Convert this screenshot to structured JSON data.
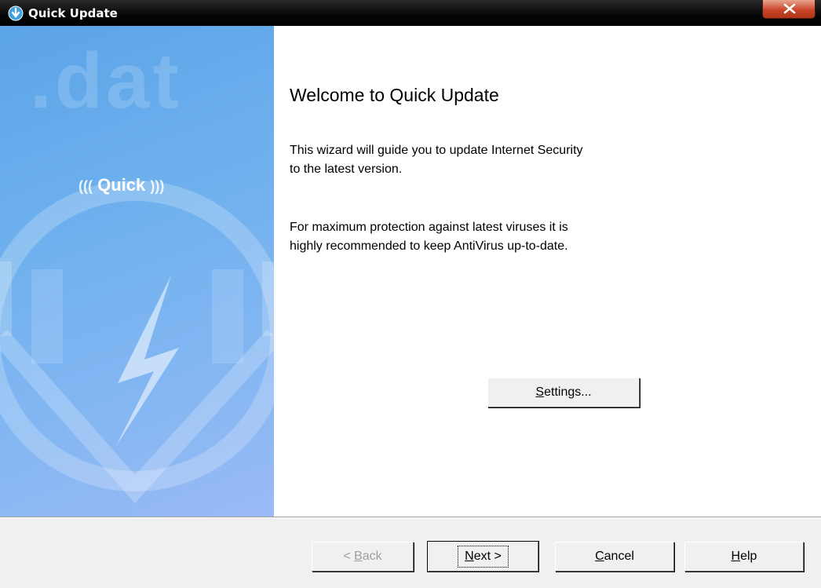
{
  "window": {
    "title": "Quick Update",
    "icon": "download-globe-icon",
    "close_icon": "close-icon"
  },
  "banner": {
    "watermark": ".dat",
    "quick_label": "Quick",
    "wave_left": "(((",
    "wave_right": ")))",
    "icon": "lightning-bolt-icon"
  },
  "content": {
    "heading": "Welcome to Quick Update",
    "paragraph1_line1": "This wizard will guide you to update Internet Security",
    "paragraph1_line2": "to the latest version.",
    "paragraph2_line1": "For maximum protection against latest viruses it is",
    "paragraph2_line2": "highly recommended to keep AntiVirus up-to-date."
  },
  "buttons": {
    "settings": {
      "mnemonic": "S",
      "rest": "ettings..."
    },
    "back": {
      "prefix": "< ",
      "mnemonic": "B",
      "rest": "ack"
    },
    "next": {
      "mnemonic": "N",
      "rest": "ext >"
    },
    "cancel": {
      "mnemonic": "C",
      "rest": "ancel"
    },
    "help": {
      "mnemonic": "H",
      "rest": "elp"
    }
  },
  "colors": {
    "banner_blue": "#6fb1ee",
    "close_red": "#c9452a"
  }
}
